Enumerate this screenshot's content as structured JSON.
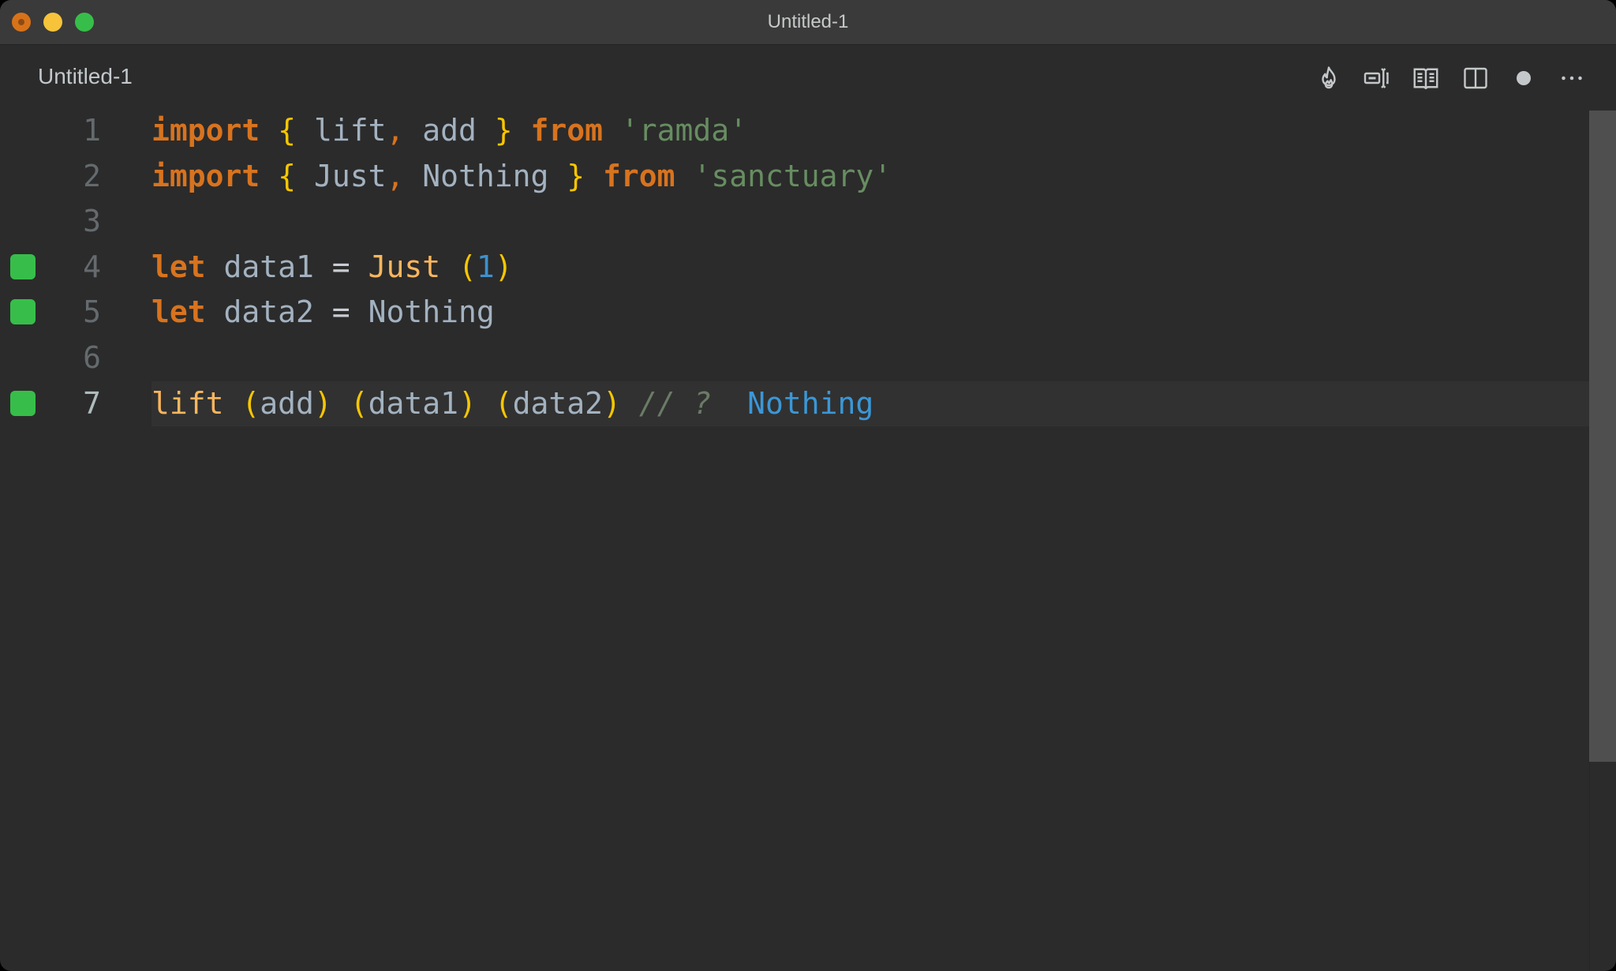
{
  "window": {
    "title": "Untitled-1",
    "traffic_lights": [
      "close",
      "minimize",
      "maximize"
    ]
  },
  "tab": {
    "label": "Untitled-1",
    "dirty": true
  },
  "toolbar": {
    "icons": [
      "flame-icon",
      "text-input-cursor-icon",
      "open-book-icon",
      "split-editor-icon",
      "unsaved-dot-icon",
      "more-ellipsis-icon"
    ]
  },
  "editor": {
    "active_line": 7,
    "lines": [
      {
        "number": "1",
        "marker": false,
        "tokens": [
          {
            "t": "import",
            "c": "kw"
          },
          {
            "t": " ",
            "c": "ident"
          },
          {
            "t": "{",
            "c": "brace"
          },
          {
            "t": " lift",
            "c": "ident"
          },
          {
            "t": ",",
            "c": "punct"
          },
          {
            "t": " add ",
            "c": "ident"
          },
          {
            "t": "}",
            "c": "brace"
          },
          {
            "t": " ",
            "c": "ident"
          },
          {
            "t": "from",
            "c": "kw"
          },
          {
            "t": " ",
            "c": "ident"
          },
          {
            "t": "'ramda'",
            "c": "str"
          }
        ]
      },
      {
        "number": "2",
        "marker": false,
        "tokens": [
          {
            "t": "import",
            "c": "kw"
          },
          {
            "t": " ",
            "c": "ident"
          },
          {
            "t": "{",
            "c": "brace"
          },
          {
            "t": " Just",
            "c": "ident"
          },
          {
            "t": ",",
            "c": "punct"
          },
          {
            "t": " Nothing ",
            "c": "ident"
          },
          {
            "t": "}",
            "c": "brace"
          },
          {
            "t": " ",
            "c": "ident"
          },
          {
            "t": "from",
            "c": "kw"
          },
          {
            "t": " ",
            "c": "ident"
          },
          {
            "t": "'sanctuary'",
            "c": "str"
          }
        ]
      },
      {
        "number": "3",
        "marker": false,
        "tokens": []
      },
      {
        "number": "4",
        "marker": true,
        "tokens": [
          {
            "t": "let",
            "c": "kw"
          },
          {
            "t": " data1 ",
            "c": "ident"
          },
          {
            "t": "=",
            "c": "op"
          },
          {
            "t": " ",
            "c": "ident"
          },
          {
            "t": "Just",
            "c": "func"
          },
          {
            "t": " ",
            "c": "ident"
          },
          {
            "t": "(",
            "c": "brace"
          },
          {
            "t": "1",
            "c": "num"
          },
          {
            "t": ")",
            "c": "brace"
          }
        ]
      },
      {
        "number": "5",
        "marker": true,
        "tokens": [
          {
            "t": "let",
            "c": "kw"
          },
          {
            "t": " data2 ",
            "c": "ident"
          },
          {
            "t": "=",
            "c": "op"
          },
          {
            "t": " Nothing",
            "c": "ident"
          }
        ]
      },
      {
        "number": "6",
        "marker": false,
        "tokens": []
      },
      {
        "number": "7",
        "marker": true,
        "tokens": [
          {
            "t": "lift",
            "c": "func"
          },
          {
            "t": " ",
            "c": "ident"
          },
          {
            "t": "(",
            "c": "brace"
          },
          {
            "t": "add",
            "c": "ident"
          },
          {
            "t": ")",
            "c": "brace"
          },
          {
            "t": " ",
            "c": "ident"
          },
          {
            "t": "(",
            "c": "brace"
          },
          {
            "t": "data1",
            "c": "ident"
          },
          {
            "t": ")",
            "c": "brace"
          },
          {
            "t": " ",
            "c": "ident"
          },
          {
            "t": "(",
            "c": "brace"
          },
          {
            "t": "data2",
            "c": "ident"
          },
          {
            "t": ")",
            "c": "brace"
          },
          {
            "t": " ",
            "c": "ident"
          },
          {
            "t": "// ?",
            "c": "cmt"
          },
          {
            "t": "  ",
            "c": "ident"
          },
          {
            "t": "Nothing",
            "c": "result"
          }
        ]
      }
    ]
  },
  "colors": {
    "background": "#2b2b2b",
    "titlebar": "#3a3a3a",
    "keyword": "#d8731e",
    "brace": "#f7c600",
    "identifier": "#a3b2c0",
    "function": "#fbb65e",
    "string": "#678d61",
    "number": "#3e91cd",
    "comment": "#6a7b66",
    "result": "#3b97d6",
    "marker": "#37be4a"
  }
}
